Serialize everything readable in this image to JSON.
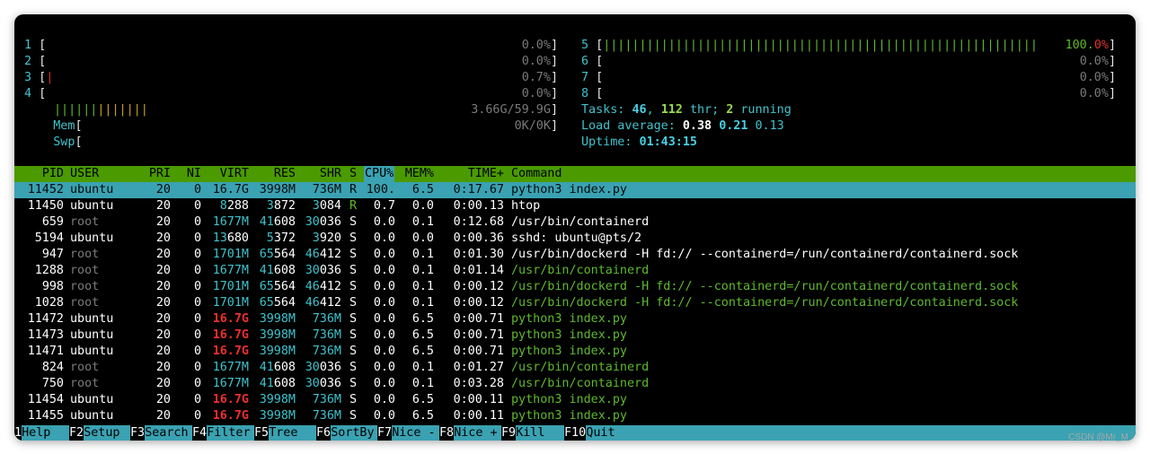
{
  "cpus_left": [
    {
      "id": "1",
      "pct": "0.0%"
    },
    {
      "id": "2",
      "pct": "0.0%"
    },
    {
      "id": "3",
      "pct": "0.7%"
    },
    {
      "id": "4",
      "pct": "0.0%"
    }
  ],
  "cpus_right": [
    {
      "id": "5",
      "pct": "100.0%"
    },
    {
      "id": "6",
      "pct": "0.0%"
    },
    {
      "id": "7",
      "pct": "0.0%"
    },
    {
      "id": "8",
      "pct": "0.0%"
    }
  ],
  "mem": {
    "label": "Mem",
    "value": "3.66G/59.9G"
  },
  "swp": {
    "label": "Swp",
    "value": "0K/0K"
  },
  "tasks": {
    "label": "Tasks:",
    "count": "46",
    "threads": "112",
    "thr_label": "thr;",
    "running": "2",
    "running_label": "running"
  },
  "load": {
    "label": "Load average:",
    "l1": "0.38",
    "l5": "0.21",
    "l15": "0.13"
  },
  "uptime": {
    "label": "Uptime:",
    "value": "01:43:15"
  },
  "columns": [
    "PID",
    "USER",
    "PRI",
    "NI",
    "VIRT",
    "RES",
    "SHR",
    "S",
    "CPU%",
    "MEM%",
    "TIME+",
    "Command"
  ],
  "processes": [
    {
      "pid": "11452",
      "user": "ubuntu",
      "pri": "20",
      "ni": "0",
      "virt": "16.7G",
      "res": "3998M",
      "shr": "736M",
      "s": "R",
      "cpu": "100.",
      "mem": "6.5",
      "time": "0:17.67",
      "cmd": "python3 index.py"
    },
    {
      "pid": "11450",
      "user": "ubuntu",
      "pri": "20",
      "ni": "0",
      "virt": "8288",
      "res": "3872",
      "shr": "3084",
      "s": "R",
      "cpu": "0.7",
      "mem": "0.0",
      "time": "0:00.13",
      "cmd": "htop"
    },
    {
      "pid": "659",
      "user": "root",
      "pri": "20",
      "ni": "0",
      "virt": "1677M",
      "res": "41608",
      "shr": "30036",
      "s": "S",
      "cpu": "0.0",
      "mem": "0.1",
      "time": "0:12.68",
      "cmd": "/usr/bin/containerd"
    },
    {
      "pid": "5194",
      "user": "ubuntu",
      "pri": "20",
      "ni": "0",
      "virt": "13680",
      "res": "5372",
      "shr": "3920",
      "s": "S",
      "cpu": "0.0",
      "mem": "0.0",
      "time": "0:00.36",
      "cmd": "sshd: ubuntu@pts/2"
    },
    {
      "pid": "947",
      "user": "root",
      "pri": "20",
      "ni": "0",
      "virt": "1701M",
      "res": "65564",
      "shr": "46412",
      "s": "S",
      "cpu": "0.0",
      "mem": "0.1",
      "time": "0:01.30",
      "cmd": "/usr/bin/dockerd -H fd:// --containerd=/run/containerd/containerd.sock"
    },
    {
      "pid": "1288",
      "user": "root",
      "pri": "20",
      "ni": "0",
      "virt": "1677M",
      "res": "41608",
      "shr": "30036",
      "s": "S",
      "cpu": "0.0",
      "mem": "0.1",
      "time": "0:01.14",
      "cmd": "/usr/bin/containerd"
    },
    {
      "pid": "998",
      "user": "root",
      "pri": "20",
      "ni": "0",
      "virt": "1701M",
      "res": "65564",
      "shr": "46412",
      "s": "S",
      "cpu": "0.0",
      "mem": "0.1",
      "time": "0:00.12",
      "cmd": "/usr/bin/dockerd -H fd:// --containerd=/run/containerd/containerd.sock"
    },
    {
      "pid": "1028",
      "user": "root",
      "pri": "20",
      "ni": "0",
      "virt": "1701M",
      "res": "65564",
      "shr": "46412",
      "s": "S",
      "cpu": "0.0",
      "mem": "0.1",
      "time": "0:00.12",
      "cmd": "/usr/bin/dockerd -H fd:// --containerd=/run/containerd/containerd.sock"
    },
    {
      "pid": "11472",
      "user": "ubuntu",
      "pri": "20",
      "ni": "0",
      "virt": "16.7G",
      "res": "3998M",
      "shr": "736M",
      "s": "S",
      "cpu": "0.0",
      "mem": "6.5",
      "time": "0:00.71",
      "cmd": "python3 index.py"
    },
    {
      "pid": "11473",
      "user": "ubuntu",
      "pri": "20",
      "ni": "0",
      "virt": "16.7G",
      "res": "3998M",
      "shr": "736M",
      "s": "S",
      "cpu": "0.0",
      "mem": "6.5",
      "time": "0:00.71",
      "cmd": "python3 index.py"
    },
    {
      "pid": "11471",
      "user": "ubuntu",
      "pri": "20",
      "ni": "0",
      "virt": "16.7G",
      "res": "3998M",
      "shr": "736M",
      "s": "S",
      "cpu": "0.0",
      "mem": "6.5",
      "time": "0:00.71",
      "cmd": "python3 index.py"
    },
    {
      "pid": "824",
      "user": "root",
      "pri": "20",
      "ni": "0",
      "virt": "1677M",
      "res": "41608",
      "shr": "30036",
      "s": "S",
      "cpu": "0.0",
      "mem": "0.1",
      "time": "0:01.27",
      "cmd": "/usr/bin/containerd"
    },
    {
      "pid": "750",
      "user": "root",
      "pri": "20",
      "ni": "0",
      "virt": "1677M",
      "res": "41608",
      "shr": "30036",
      "s": "S",
      "cpu": "0.0",
      "mem": "0.1",
      "time": "0:03.28",
      "cmd": "/usr/bin/containerd"
    },
    {
      "pid": "11454",
      "user": "ubuntu",
      "pri": "20",
      "ni": "0",
      "virt": "16.7G",
      "res": "3998M",
      "shr": "736M",
      "s": "S",
      "cpu": "0.0",
      "mem": "6.5",
      "time": "0:00.11",
      "cmd": "python3 index.py"
    },
    {
      "pid": "11455",
      "user": "ubuntu",
      "pri": "20",
      "ni": "0",
      "virt": "16.7G",
      "res": "3998M",
      "shr": "736M",
      "s": "S",
      "cpu": "0.0",
      "mem": "6.5",
      "time": "0:00.11",
      "cmd": "python3 index.py"
    }
  ],
  "fkeys": [
    {
      "key": "1",
      "label": "Help"
    },
    {
      "key": "F2",
      "label": "Setup"
    },
    {
      "key": "F3",
      "label": "Search"
    },
    {
      "key": "F4",
      "label": "Filter"
    },
    {
      "key": "F5",
      "label": "Tree"
    },
    {
      "key": "F6",
      "label": "SortBy"
    },
    {
      "key": "F7",
      "label": "Nice -"
    },
    {
      "key": "F8",
      "label": "Nice +"
    },
    {
      "key": "F9",
      "label": "Kill"
    },
    {
      "key": "F10",
      "label": "Quit"
    }
  ],
  "watermark": "CSDN @Mr_M",
  "colors": {
    "header_bar": "#4a9a00",
    "selected_row": "#3aa2b2",
    "function_bar": "#3aa2b2",
    "terminal_bg": "#000000"
  }
}
